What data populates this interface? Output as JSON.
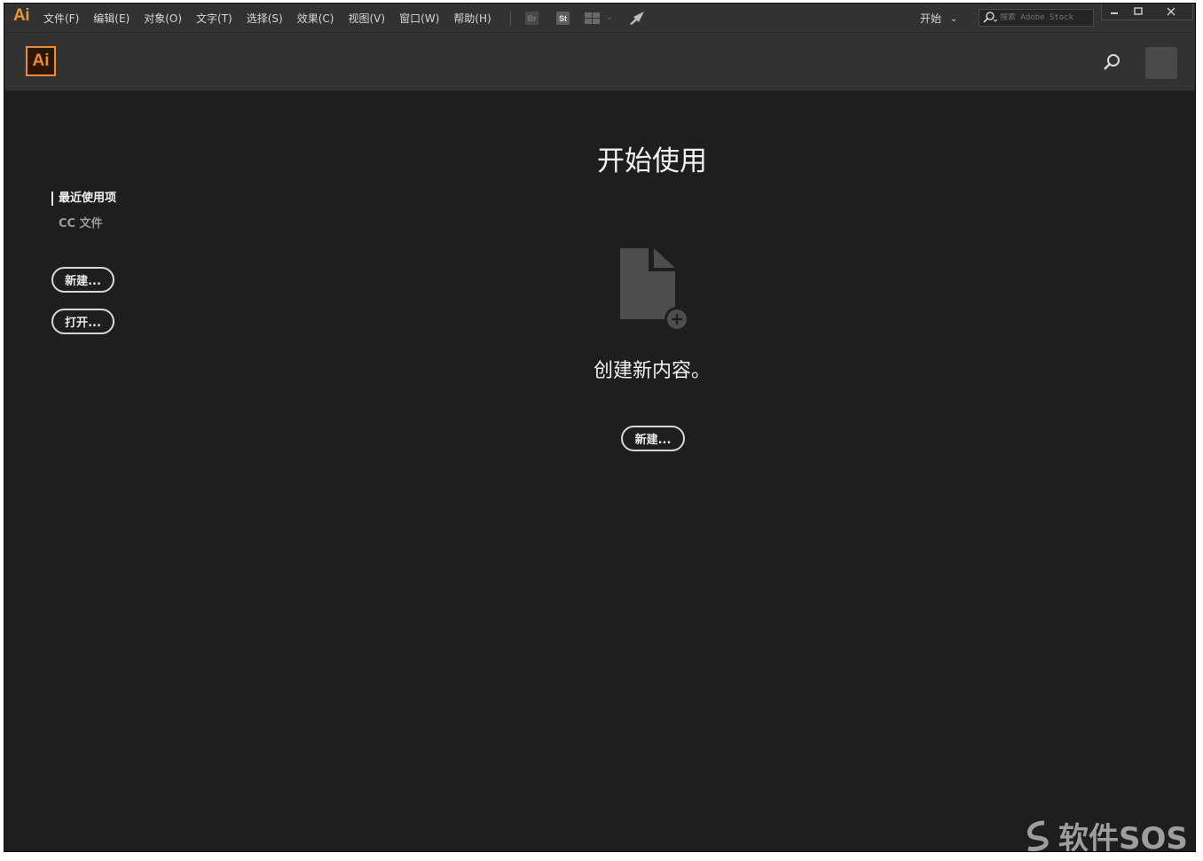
{
  "menubar": {
    "app_logo": "Ai",
    "items": [
      "文件(F)",
      "编辑(E)",
      "对象(O)",
      "文字(T)",
      "选择(S)",
      "效果(C)",
      "视图(V)",
      "窗口(W)",
      "帮助(H)"
    ],
    "bridge_badge": "Br",
    "stock_badge": "St",
    "workspace_label": "开始",
    "stock_search_placeholder": "搜索 Adobe Stock",
    "icons": [
      "layout-icon",
      "rocket-icon",
      "chevron-down-icon",
      "search-icon",
      "minimize-icon",
      "maximize-icon",
      "close-icon"
    ]
  },
  "header": {
    "logo_text": "Ai"
  },
  "sidebar": {
    "recent_label": "最近使用项",
    "cc_files_label": "CC 文件",
    "new_button": "新建...",
    "open_button": "打开..."
  },
  "main": {
    "title": "开始使用",
    "create_text": "创建新内容。",
    "new_button": "新建..."
  },
  "watermark": {
    "text": "软件SOS"
  },
  "colors": {
    "accent": "#ef8a30",
    "background": "#1e1e1e",
    "bar": "#323232"
  }
}
